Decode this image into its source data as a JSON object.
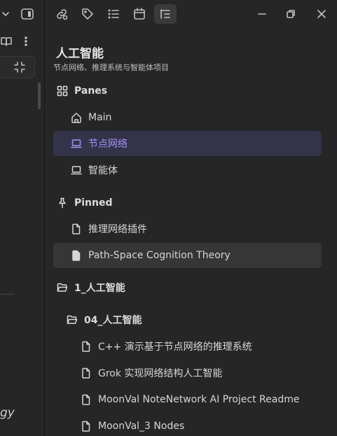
{
  "panel": {
    "title": "人工智能",
    "subtitle": "节点网络、推理系统与智能体项目"
  },
  "left": {
    "fragment_text": "gy"
  },
  "sections": {
    "panes": {
      "label": "Panes",
      "items": [
        {
          "label": "Main"
        },
        {
          "label": "节点网络"
        },
        {
          "label": "智能体"
        }
      ]
    },
    "pinned": {
      "label": "Pinned",
      "items": [
        {
          "label": "推理网络插件"
        },
        {
          "label": "Path-Space Cognition Theory"
        }
      ]
    },
    "folder1": {
      "label": "1_人工智能",
      "subfolder": {
        "label": "04_人工智能",
        "items": [
          {
            "label": "C++ 演示基于节点网络的推理系统"
          },
          {
            "label": "Grok 实现网络结构人工智能"
          },
          {
            "label": "MoonVal NoteNetwork AI Project Readme"
          },
          {
            "label": "MoonVal_3 Nodes"
          }
        ]
      }
    }
  },
  "colors": {
    "accent": "#a692f5",
    "selected_bg": "#33334a",
    "background": "#262626"
  }
}
